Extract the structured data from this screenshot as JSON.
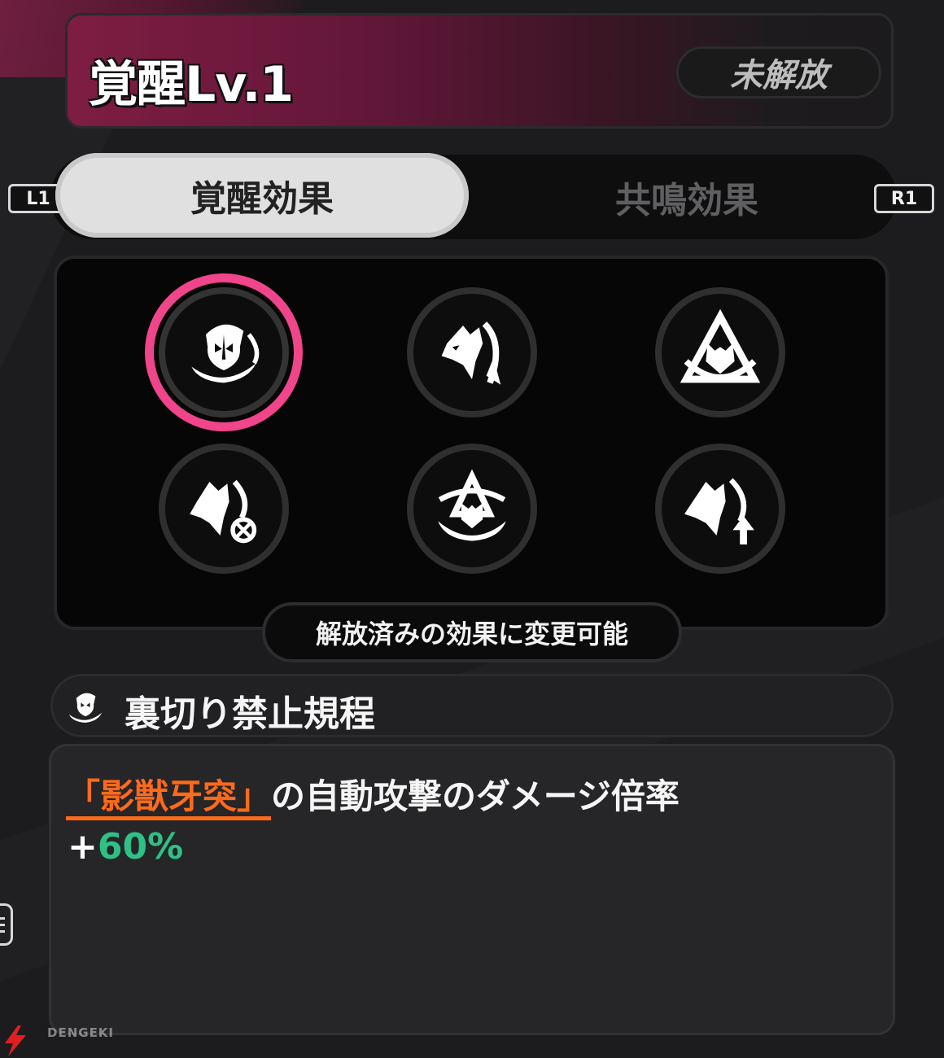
{
  "header": {
    "title": "覚醒Lv.1",
    "status": "未解放"
  },
  "tabs": [
    {
      "label": "覚醒効果",
      "active": true
    },
    {
      "label": "共鳴効果",
      "active": false
    }
  ],
  "key_hints": {
    "left": "L1",
    "right": "R1"
  },
  "skills": [
    {
      "icon": "wolf-hood-ring-icon",
      "selected": true
    },
    {
      "icon": "wolf-slash-icon",
      "selected": false
    },
    {
      "icon": "wolf-triangle-icon",
      "selected": false
    },
    {
      "icon": "wolf-target-icon",
      "selected": false
    },
    {
      "icon": "wolf-orbit-icon",
      "selected": false
    },
    {
      "icon": "wolf-arrow-up-icon",
      "selected": false
    }
  ],
  "note": "解放済みの効果に変更可能",
  "effect": {
    "name": "裏切り禁止規程",
    "skill_ref": "「影獣牙突」",
    "description": "の自動攻撃のダメージ倍率",
    "value_sign": "+",
    "value": "60%"
  },
  "watermark": "DENGEKI",
  "colors": {
    "accent_pink": "#f0458b",
    "skill_ref_orange": "#ff6a1a",
    "value_green": "#2fc086",
    "header_red": "#7e1d42"
  }
}
